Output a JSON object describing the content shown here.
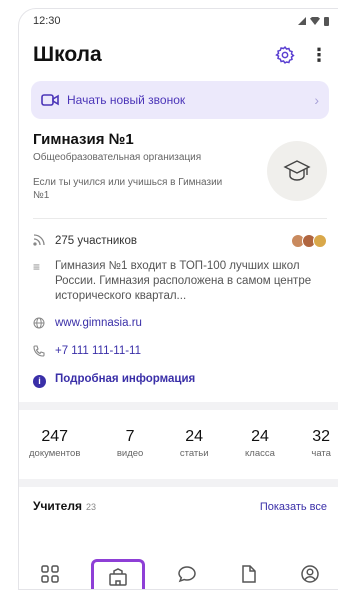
{
  "statusbar": {
    "time": "12:30"
  },
  "header": {
    "title": "Школа"
  },
  "call_banner": {
    "label": "Начать новый звонок"
  },
  "school": {
    "name": "Гимназия №1",
    "type": "Общеобразовательная организация",
    "hint": "Если ты учился или учишься в Гимназии №1"
  },
  "info": {
    "members": "275 участников",
    "description": "Гимназия №1 входит в ТОП-100 лучших школ России. Гимназия расположена в самом центре исторического квартал...",
    "website": "www.gimnasia.ru",
    "phone": "+7 111 111-11-11",
    "more": "Подробная информация"
  },
  "stats": [
    {
      "num": "247",
      "label": "документов"
    },
    {
      "num": "7",
      "label": "видео"
    },
    {
      "num": "24",
      "label": "статьи"
    },
    {
      "num": "24",
      "label": "класса"
    },
    {
      "num": "32",
      "label": "чата"
    }
  ],
  "teachers": {
    "title": "Учителя",
    "count": "23",
    "show_all": "Показать все"
  },
  "colors": {
    "accent": "#3a2fa8",
    "banner_bg": "#ece9fb",
    "active_tab": "#8e3fd6"
  },
  "tabs": [
    "apps-icon",
    "school-icon",
    "chat-icon",
    "document-icon",
    "profile-icon"
  ]
}
